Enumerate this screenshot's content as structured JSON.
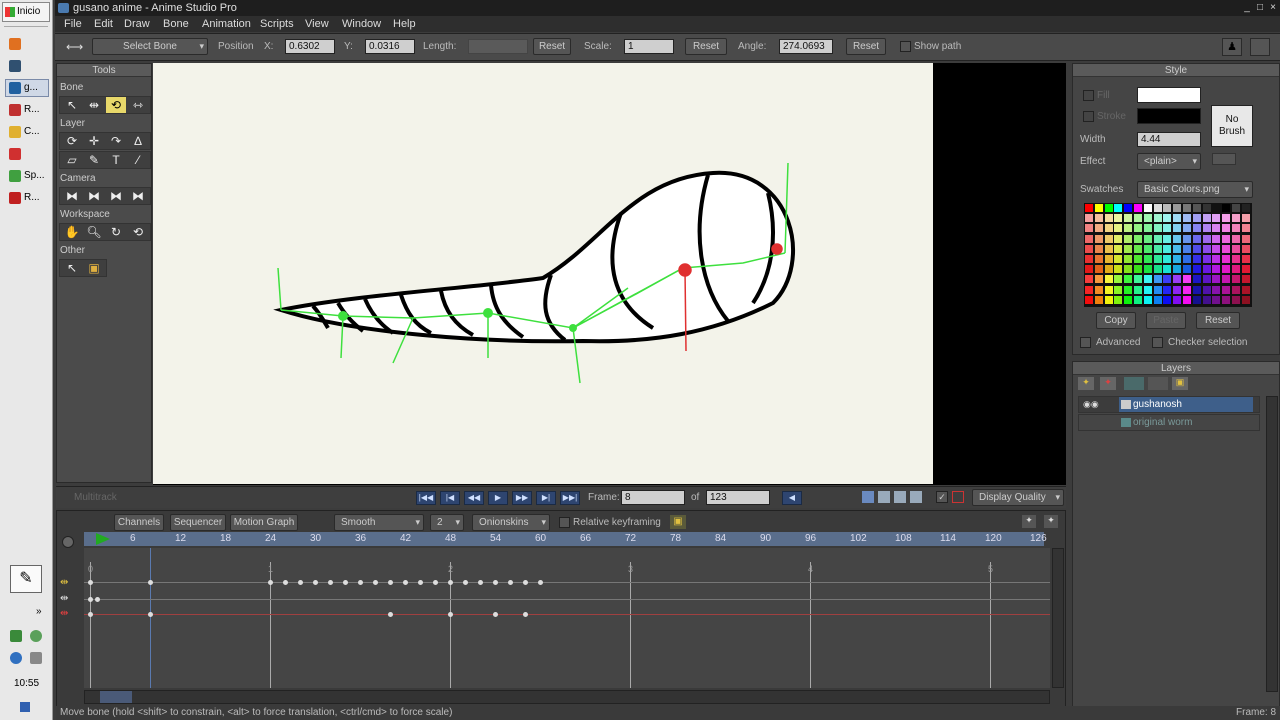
{
  "taskbar": {
    "start_label": "Inicio",
    "items": [
      {
        "label": "",
        "color": "#e07020"
      },
      {
        "label": "",
        "color": "#305070"
      },
      {
        "label": "g...",
        "color": "#2060a0",
        "active": true
      },
      {
        "label": "R...",
        "color": "#c03030"
      },
      {
        "label": "C...",
        "color": "#e0b030"
      },
      {
        "label": "",
        "color": "#d03030"
      },
      {
        "label": "Sp...",
        "color": "#40a040"
      },
      {
        "label": "R...",
        "color": "#c02020"
      }
    ],
    "clock": "10:55"
  },
  "window": {
    "title": "gusano anime - Anime Studio Pro",
    "controls": {
      "minimize": "_",
      "maximize": "□",
      "close": "×"
    }
  },
  "menus": [
    "File",
    "Edit",
    "Draw",
    "Bone",
    "Animation",
    "Scripts",
    "View",
    "Window",
    "Help"
  ],
  "tool_options": {
    "tool_dropdown": "Select Bone",
    "position_label": "Position",
    "x_label": "X:",
    "x_value": "0.6302",
    "y_label": "Y:",
    "y_value": "0.0316",
    "length_label": "Length:",
    "length_value": "",
    "reset1": "Reset",
    "scale_label": "Scale:",
    "scale_value": "1",
    "reset2": "Reset",
    "angle_label": "Angle:",
    "angle_value": "274.0693",
    "reset3": "Reset",
    "show_path": "Show path"
  },
  "tools_panel": {
    "title": "Tools",
    "sections": {
      "bone": "Bone",
      "layer": "Layer",
      "camera": "Camera",
      "workspace": "Workspace",
      "other": "Other"
    },
    "layer_text_tool": "T"
  },
  "transport": {
    "frame_label": "Frame:",
    "frame_value": "8",
    "of_label": "of",
    "total_value": "123",
    "display_quality": "Display Quality",
    "left_label": "Multitrack"
  },
  "timeline": {
    "tabs": [
      "Channels",
      "Sequencer",
      "Motion Graph"
    ],
    "interp": "Smooth",
    "interp_count": "2",
    "onionskins": "Onionskins",
    "relative_keyframing": "Relative keyframing",
    "ruler": [
      "6",
      "12",
      "18",
      "24",
      "30",
      "36",
      "42",
      "48",
      "54",
      "60",
      "66",
      "72",
      "78",
      "84",
      "90",
      "96",
      "102",
      "108",
      "114",
      "120",
      "126"
    ],
    "sections": [
      "0",
      "1",
      "2",
      "3",
      "4",
      "5"
    ]
  },
  "style_panel": {
    "title": "Style",
    "fill_label": "Fill",
    "stroke_label": "Stroke",
    "fill_color": "#ffffff",
    "stroke_color": "#000000",
    "width_label": "Width",
    "width_value": "4.44",
    "effect_label": "Effect",
    "effect_value": "<plain>",
    "no_brush": "No Brush",
    "swatches_label": "Swatches",
    "swatches_value": "Basic Colors.png",
    "copy": "Copy",
    "paste": "Paste",
    "reset": "Reset",
    "advanced": "Advanced",
    "checker": "Checker selection"
  },
  "layers_panel": {
    "title": "Layers",
    "layers": [
      {
        "name": "gushanosh",
        "selected": true
      },
      {
        "name": "original worm",
        "selected": false
      }
    ]
  },
  "status": {
    "message": "Move bone (hold <shift> to constrain, <alt> to force translation, <ctrl/cmd> to force scale)",
    "frame": "Frame: 8"
  }
}
